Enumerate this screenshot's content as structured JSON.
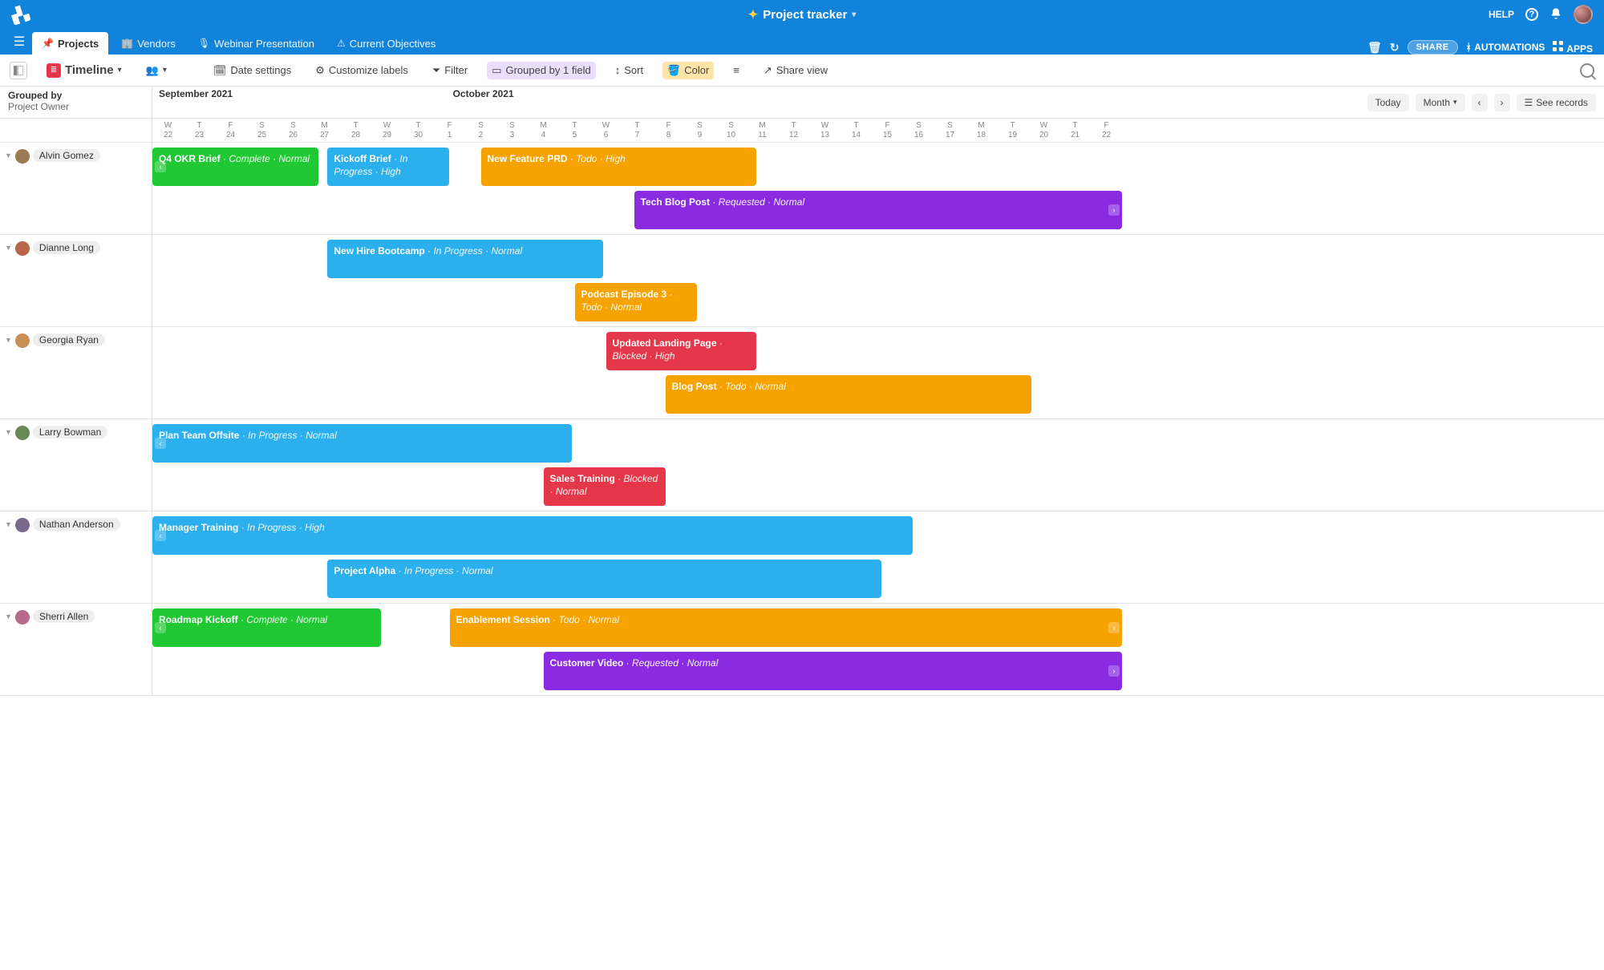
{
  "header": {
    "title": "Project tracker",
    "help_label": "HELP"
  },
  "tabs": [
    {
      "label": "Projects",
      "icon": "pushpin-icon",
      "active": true
    },
    {
      "label": "Vendors",
      "icon": "vendors-icon",
      "active": false
    },
    {
      "label": "Webinar Presentation",
      "icon": "webinar-icon",
      "active": false
    },
    {
      "label": "Current Objectives",
      "icon": "warning-icon",
      "active": false
    }
  ],
  "tabs_right": {
    "share": "SHARE",
    "automations": "AUTOMATIONS",
    "apps": "APPS"
  },
  "toolbar": {
    "view_name": "Timeline",
    "date_settings": "Date settings",
    "customize_labels": "Customize labels",
    "filter": "Filter",
    "grouped": "Grouped by 1 field",
    "sort": "Sort",
    "color": "Color",
    "share_view": "Share view"
  },
  "grouping": {
    "label": "Grouped by",
    "field": "Project Owner"
  },
  "timeline_controls": {
    "today": "Today",
    "scale": "Month",
    "see_records": "See records"
  },
  "months": [
    {
      "label": "September 2021",
      "col": 0
    },
    {
      "label": "October 2021",
      "col": 9.4
    }
  ],
  "days": [
    {
      "d": "W",
      "n": "22"
    },
    {
      "d": "T",
      "n": "23"
    },
    {
      "d": "F",
      "n": "24"
    },
    {
      "d": "S",
      "n": "25"
    },
    {
      "d": "S",
      "n": "26"
    },
    {
      "d": "M",
      "n": "27"
    },
    {
      "d": "T",
      "n": "28"
    },
    {
      "d": "W",
      "n": "29"
    },
    {
      "d": "T",
      "n": "30"
    },
    {
      "d": "F",
      "n": "1"
    },
    {
      "d": "S",
      "n": "2"
    },
    {
      "d": "S",
      "n": "3"
    },
    {
      "d": "M",
      "n": "4"
    },
    {
      "d": "T",
      "n": "5"
    },
    {
      "d": "W",
      "n": "6"
    },
    {
      "d": "T",
      "n": "7"
    },
    {
      "d": "F",
      "n": "8"
    },
    {
      "d": "S",
      "n": "9"
    },
    {
      "d": "S",
      "n": "10"
    },
    {
      "d": "M",
      "n": "11"
    },
    {
      "d": "T",
      "n": "12"
    },
    {
      "d": "W",
      "n": "13"
    },
    {
      "d": "T",
      "n": "14"
    },
    {
      "d": "F",
      "n": "15"
    },
    {
      "d": "S",
      "n": "16"
    },
    {
      "d": "S",
      "n": "17"
    },
    {
      "d": "M",
      "n": "18"
    },
    {
      "d": "T",
      "n": "19"
    },
    {
      "d": "W",
      "n": "20"
    },
    {
      "d": "T",
      "n": "21"
    },
    {
      "d": "F",
      "n": "22"
    }
  ],
  "day_width": 39,
  "groups": [
    {
      "owner": "Alvin Gomez",
      "avatar": "#9b7b54",
      "bars": [
        {
          "name": "Q4 OKR Brief",
          "status": "Complete",
          "priority": "Normal",
          "color": "green",
          "start": 0,
          "span": 5.3,
          "row": 0,
          "edge_left": true
        },
        {
          "name": "Kickoff Brief",
          "status": "In Progress",
          "priority": "High",
          "color": "blue",
          "start": 5.6,
          "span": 3.9,
          "row": 0
        },
        {
          "name": "New Feature PRD",
          "status": "Todo",
          "priority": "High",
          "color": "orange",
          "start": 10.5,
          "span": 8.8,
          "row": 0
        },
        {
          "name": "Tech Blog Post",
          "status": "Requested",
          "priority": "Normal",
          "color": "purple",
          "start": 15.4,
          "span": 15.6,
          "row": 1,
          "edge_right": true
        }
      ]
    },
    {
      "owner": "Dianne Long",
      "avatar": "#b8654a",
      "bars": [
        {
          "name": "New Hire Bootcamp",
          "status": "In Progress",
          "priority": "Normal",
          "color": "blue",
          "start": 5.6,
          "span": 8.8,
          "row": 0
        },
        {
          "name": "Podcast Episode 3",
          "status": "Todo",
          "priority": "Normal",
          "color": "orange",
          "start": 13.5,
          "span": 3.9,
          "row": 1
        }
      ]
    },
    {
      "owner": "Georgia Ryan",
      "avatar": "#c98f55",
      "bars": [
        {
          "name": "Updated Landing Page",
          "status": "Blocked",
          "priority": "High",
          "color": "pink",
          "start": 14.5,
          "span": 4.8,
          "row": 0
        },
        {
          "name": "Blog Post",
          "status": "Todo",
          "priority": "Normal",
          "color": "orange",
          "start": 16.4,
          "span": 11.7,
          "row": 1
        }
      ]
    },
    {
      "owner": "Larry Bowman",
      "avatar": "#6a8a55",
      "bars": [
        {
          "name": "Plan Team Offsite",
          "status": "In Progress",
          "priority": "Normal",
          "color": "blue",
          "start": 0,
          "span": 13.4,
          "row": 0,
          "edge_left": true
        },
        {
          "name": "Sales Training",
          "status": "Blocked",
          "priority": "Normal",
          "color": "pink",
          "start": 12.5,
          "span": 3.9,
          "row": 1
        }
      ]
    },
    {
      "owner": "Nathan Anderson",
      "avatar": "#7a6a8a",
      "bars": [
        {
          "name": "Manager Training",
          "status": "In Progress",
          "priority": "High",
          "color": "blue",
          "start": 0,
          "span": 24.3,
          "row": 0,
          "edge_left": true
        },
        {
          "name": "Project Alpha",
          "status": "In Progress",
          "priority": "Normal",
          "color": "blue",
          "start": 5.6,
          "span": 17.7,
          "row": 1
        }
      ]
    },
    {
      "owner": "Sherri Allen",
      "avatar": "#b86a8a",
      "bars": [
        {
          "name": "Roadmap Kickoff",
          "status": "Complete",
          "priority": "Normal",
          "color": "green",
          "start": 0,
          "span": 7.3,
          "row": 0,
          "edge_left": true
        },
        {
          "name": "Enablement Session",
          "status": "Todo",
          "priority": "Normal",
          "color": "orange",
          "start": 9.5,
          "span": 21.5,
          "row": 0,
          "edge_right": true
        },
        {
          "name": "Customer Video",
          "status": "Requested",
          "priority": "Normal",
          "color": "purple",
          "start": 12.5,
          "span": 18.5,
          "row": 1,
          "edge_right": true
        }
      ]
    }
  ]
}
